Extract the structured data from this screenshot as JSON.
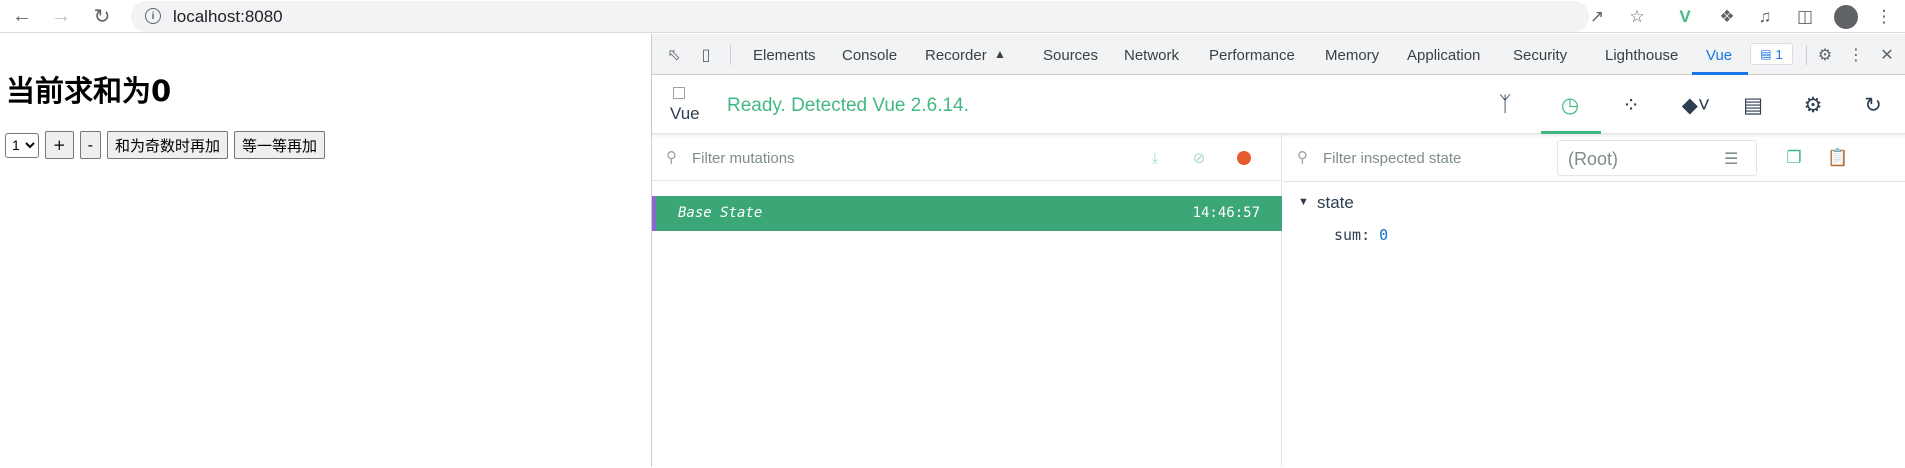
{
  "browser": {
    "url": "localhost:8080"
  },
  "page": {
    "heading": "当前求和为0",
    "select_value": "1",
    "buttons": {
      "plus": "+",
      "minus": "-",
      "odd_add": "和为奇数时再加",
      "wait_add": "等一等再加"
    }
  },
  "devtools": {
    "tabs": [
      "Elements",
      "Console",
      "Recorder",
      "Sources",
      "Network",
      "Performance",
      "Memory",
      "Application",
      "Security",
      "Lighthouse",
      "Vue"
    ],
    "active_tab": "Vue",
    "issue_count": "1",
    "vue": {
      "logo_alt": "Vue",
      "status": "Ready. Detected Vue 2.6.14.",
      "mutations_filter_placeholder": "Filter mutations",
      "base_state_label": "Base State",
      "base_state_time": "14:46:57",
      "state_filter_placeholder": "Filter inspected state",
      "root_select": "(Root)",
      "state_group": "state",
      "state_key": "sum",
      "state_value": "0"
    }
  },
  "colors": {
    "vue_green": "#42b983",
    "base_row": "#3ba776",
    "record_dot": "#e55b2d",
    "tab_active": "#1a73e8"
  }
}
